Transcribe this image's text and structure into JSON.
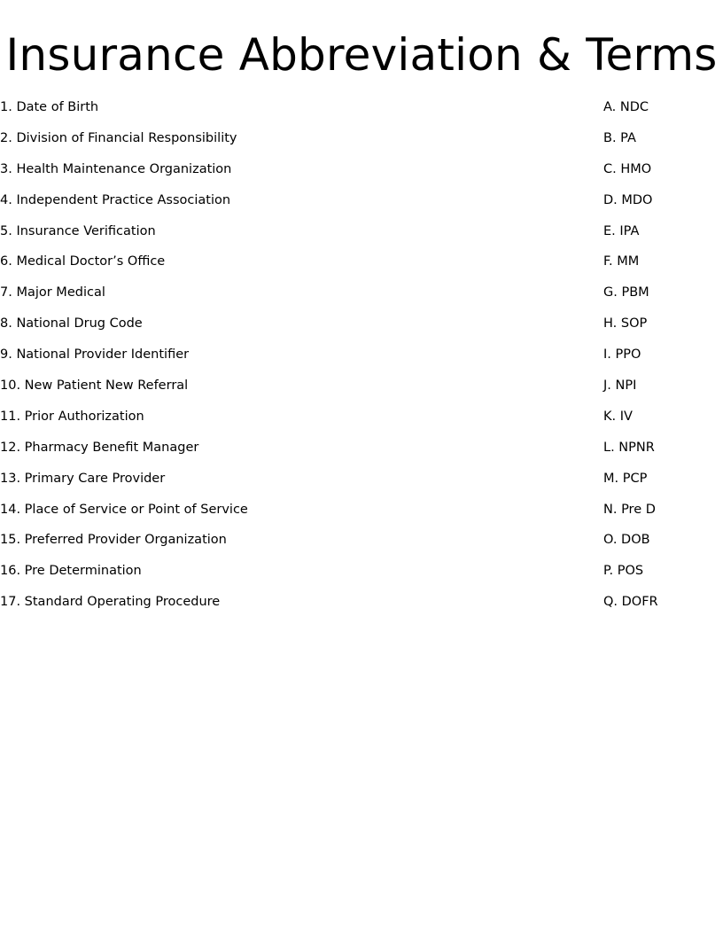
{
  "title": "Insurance Abbreviation & Terms",
  "terms": [
    "1. Date of Birth",
    "2. Division of Financial Responsibility",
    "3. Health Maintenance Organization",
    "4. Independent Practice Association",
    "5. Insurance Verification",
    "6. Medical Doctor’s Office",
    "7. Major Medical",
    "8. National Drug Code",
    "9. National Provider Identifier",
    "10. New Patient New Referral",
    "11. Prior Authorization",
    "12. Pharmacy Benefit Manager",
    "13. Primary Care Provider",
    "14. Place of Service or Point of Service",
    "15. Preferred Provider Organization",
    "16. Pre Determination",
    "17. Standard Operating Procedure"
  ],
  "abbreviations": [
    "A. NDC",
    "B. PA",
    "C. HMO",
    "D. MDO",
    "E. IPA",
    "F. MM",
    "G. PBM",
    "H. SOP",
    "I. PPO",
    "J. NPI",
    "K. IV",
    "L. NPNR",
    "M. PCP",
    "N. Pre D",
    "O. DOB",
    "P. POS",
    "Q. DOFR"
  ]
}
